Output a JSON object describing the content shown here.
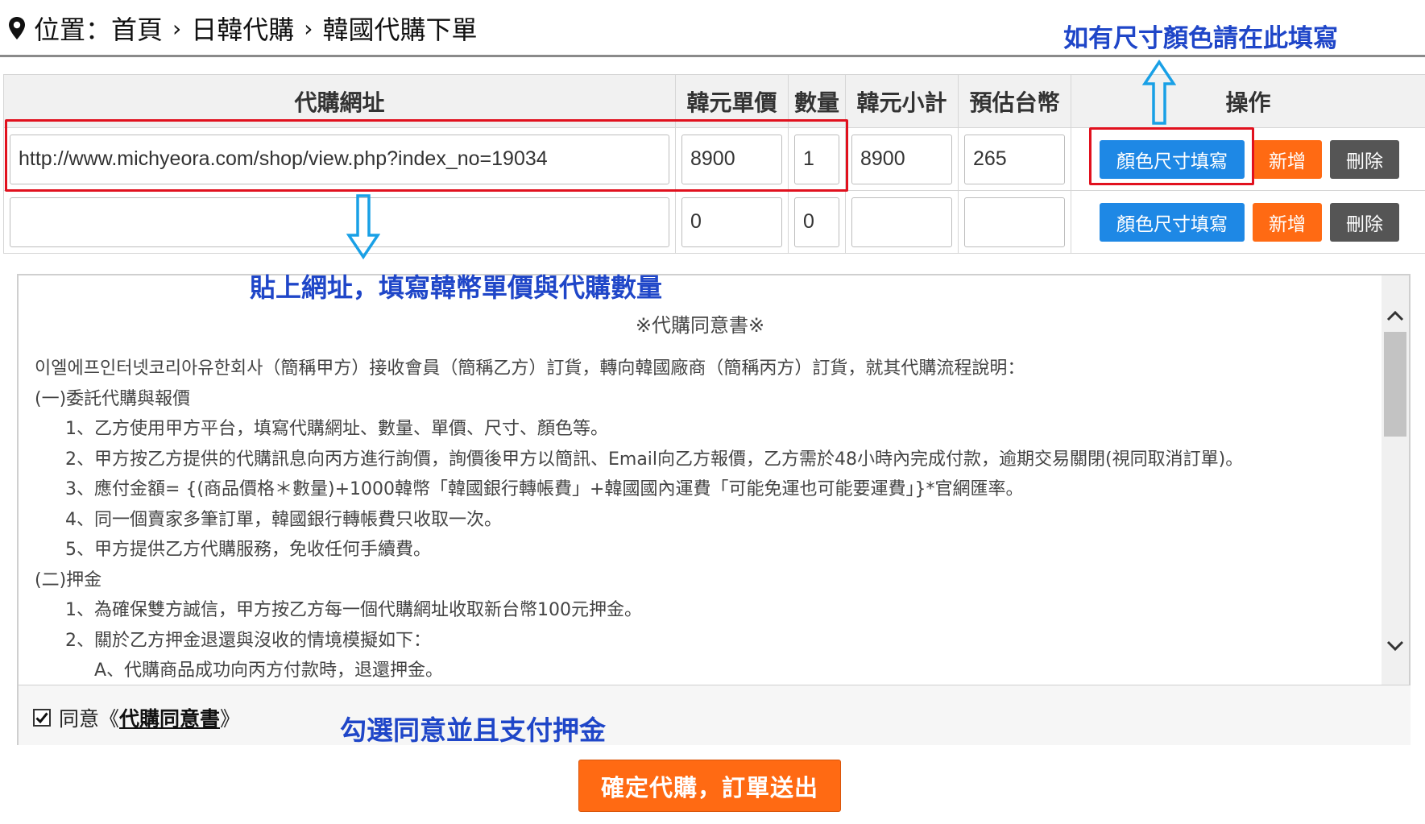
{
  "breadcrumb": {
    "prefix": "位置：",
    "items": [
      "首頁",
      "日韓代購",
      "韓國代購下單"
    ],
    "separator": "›"
  },
  "annotations": {
    "top_right": "如有尺寸顏色請在此填寫",
    "middle": "貼上網址，填寫韓幣單價與代購數量",
    "bottom": "勾選同意並且支付押金"
  },
  "table": {
    "headers": [
      "代購網址",
      "韓元單價",
      "數量",
      "韓元小計",
      "預估台幣",
      "操作"
    ],
    "rows": [
      {
        "url": "http://www.michyeora.com/shop/view.php?index_no=19034",
        "price": "8900",
        "qty": "1",
        "subtotal": "8900",
        "twd": "265"
      },
      {
        "url": "",
        "price": "0",
        "qty": "0",
        "subtotal": "",
        "twd": ""
      }
    ],
    "buttons": {
      "color_size": "顏色尺寸填寫",
      "add": "新增",
      "delete": "刪除"
    }
  },
  "agreement": {
    "title": "※代購同意書※",
    "lines": [
      "이엘에프인터넷코리아유한회사（簡稱甲方）接收會員（簡稱乙方）訂貨，轉向韓國廠商（簡稱丙方）訂貨，就其代購流程說明：",
      "(一)委託代購與報價",
      "1、乙方使用甲方平台，填寫代購網址、數量、單價、尺寸、顏色等。",
      "2、甲方按乙方提供的代購訊息向丙方進行詢價，詢價後甲方以簡訊、Email向乙方報價，乙方需於48小時內完成付款，逾期交易關閉(視同取消訂單)。",
      "3、應付金額= {(商品價格＊數量)+1000韓幣「韓國銀行轉帳費」+韓國國內運費「可能免運也可能要運費」}*官網匯率。",
      "4、同一個賣家多筆訂單，韓國銀行轉帳費只收取一次。",
      "5、甲方提供乙方代購服務，免收任何手續費。",
      "(二)押金",
      "1、為確保雙方誠信，甲方按乙方每一個代購網址收取新台幣100元押金。",
      "2、關於乙方押金退還與沒收的情境模擬如下：",
      "A、代購商品成功向丙方付款時，退還押金。"
    ],
    "agree_prefix": "同意《",
    "agree_link": "代購同意書",
    "agree_suffix": "》",
    "agree_checked": true
  },
  "submit_label": "確定代購，訂單送出",
  "colors": {
    "blue_button": "#1e88e5",
    "orange_button": "#ff6a13",
    "gray_button": "#555555",
    "annotation_blue": "#1f46c8",
    "highlight_red": "#e1111e"
  }
}
